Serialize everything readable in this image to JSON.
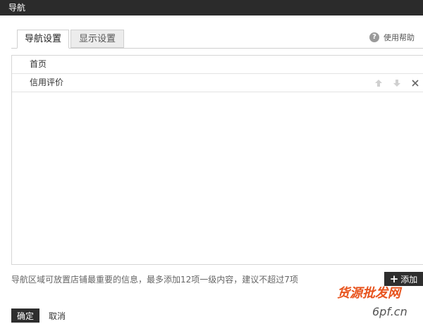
{
  "window": {
    "title": "导航"
  },
  "tabs": [
    {
      "label": "导航设置",
      "active": true
    },
    {
      "label": "显示设置",
      "active": false
    }
  ],
  "help": {
    "label": "使用帮助",
    "icon": "question-icon"
  },
  "nav_items": [
    {
      "label": "首页",
      "actions": []
    },
    {
      "label": "信用评价",
      "actions": [
        "arrow-up-icon",
        "arrow-down-icon",
        "close-icon"
      ]
    }
  ],
  "hint": "导航区域可放置店铺最重要的信息，最多添加12项一级内容，建议不超过7项",
  "buttons": {
    "add": "添加",
    "confirm": "确定",
    "cancel": "取消"
  },
  "watermark": {
    "line1": "货源批发网",
    "line2": "6pf.cn"
  },
  "colors": {
    "titlebar": "#2b2b2b",
    "button": "#2e2e2e",
    "border": "#d6d6d6",
    "watermark": "#e8541e"
  }
}
